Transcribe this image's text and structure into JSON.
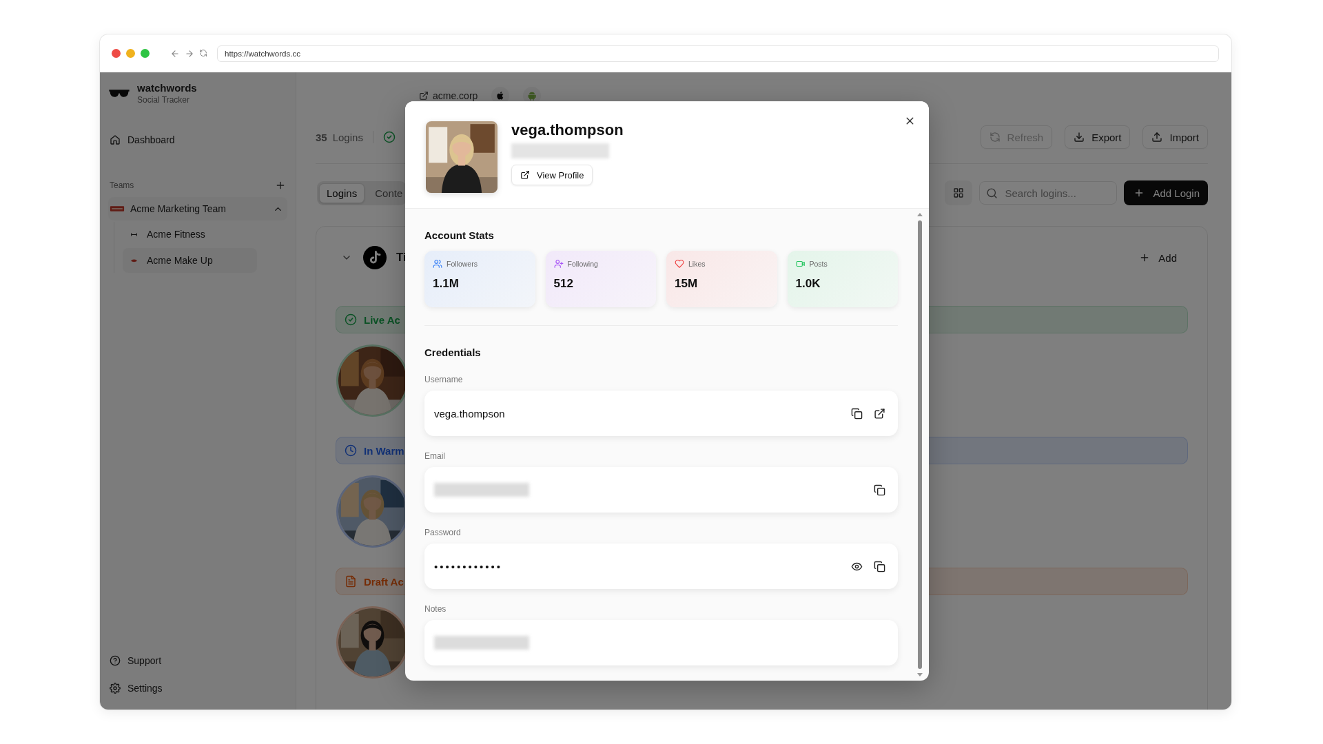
{
  "browser": {
    "url": "https://watchwords.cc"
  },
  "sidebar": {
    "app_name": "watchwords",
    "tagline": "Social Tracker",
    "nav": [
      {
        "label": "Dashboard",
        "kind": "home"
      }
    ],
    "teams_heading": "Teams",
    "teams": [
      {
        "name": "Acme Marketing Team",
        "expanded": true,
        "children": [
          {
            "name": "Acme Fitness",
            "kind": "fitness",
            "selected": false
          },
          {
            "name": "Acme Make Up",
            "kind": "makeup",
            "selected": true
          }
        ]
      }
    ],
    "footer": [
      {
        "label": "Support",
        "kind": "help"
      },
      {
        "label": "Settings",
        "kind": "settings"
      }
    ]
  },
  "main": {
    "website": "acme.corp",
    "platforms": [
      {
        "kind": "apple"
      },
      {
        "kind": "android"
      }
    ],
    "login_count": "35",
    "login_label": "Logins",
    "actions": [
      {
        "label": "Refresh",
        "kind": "refresh",
        "disabled": true
      },
      {
        "label": "Export",
        "kind": "export",
        "disabled": false
      },
      {
        "label": "Import",
        "kind": "import",
        "disabled": false
      }
    ],
    "tabs": [
      {
        "label": "Logins",
        "selected": true
      },
      {
        "label": "Conte",
        "selected": false
      }
    ],
    "search": {
      "placeholder": "Search logins..."
    },
    "add_button": "Add Login",
    "platform_group": {
      "name": "Ti",
      "expanded": true,
      "add_label": "Add",
      "sections": [
        {
          "label": "Live Ac",
          "kind": "live"
        },
        {
          "label": "In Warm",
          "kind": "warmup"
        },
        {
          "label": "Draft Ac",
          "kind": "draft"
        }
      ]
    }
  },
  "modal": {
    "username": "vega.thompson",
    "subtitle_redacted": true,
    "view_profile": "View Profile",
    "stats_heading": "Account Stats",
    "stats": [
      {
        "kind": "followers",
        "label": "Followers",
        "value": "1.1M"
      },
      {
        "kind": "following",
        "label": "Following",
        "value": "512"
      },
      {
        "kind": "likes",
        "label": "Likes",
        "value": "15M"
      },
      {
        "kind": "posts",
        "label": "Posts",
        "value": "1.0K"
      }
    ],
    "credentials_heading": "Credentials",
    "fields": [
      {
        "label": "Username",
        "value": "vega.thompson",
        "redacted": false,
        "copyable": true,
        "openable": true
      },
      {
        "label": "Email",
        "redacted": true,
        "copyable": true
      },
      {
        "label": "Password",
        "value": "••••••••••••",
        "redacted": false,
        "masked": true,
        "revealable": true,
        "copyable": true
      },
      {
        "label": "Notes",
        "redacted": true
      }
    ]
  }
}
